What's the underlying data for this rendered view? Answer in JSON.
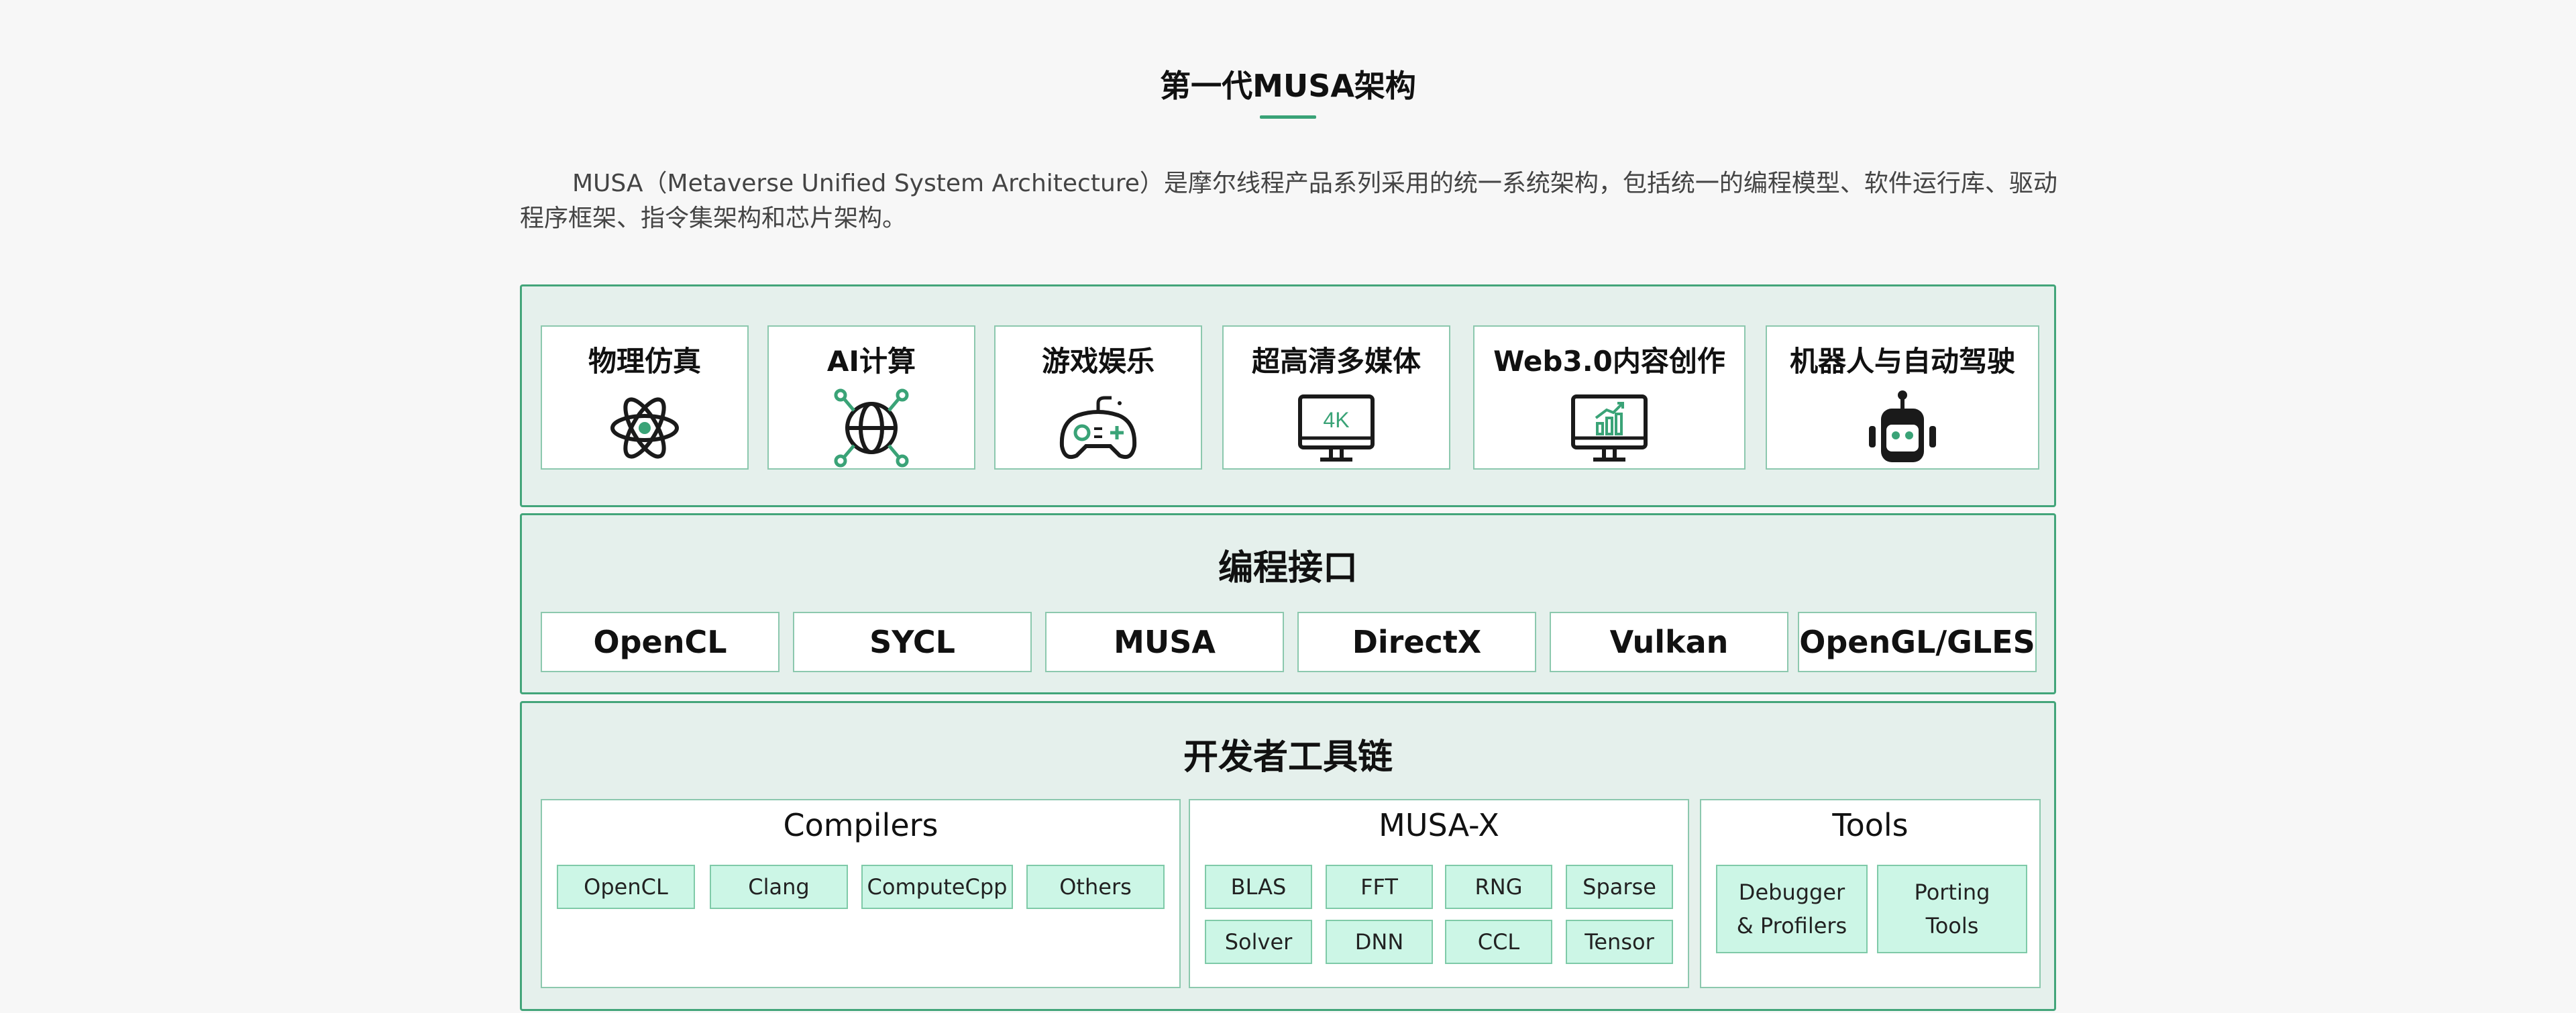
{
  "header": {
    "title": "第一代MUSA架构",
    "intro": "MUSA（Metaverse Unified System Architecture）是摩尔线程产品系列采用的统一系统架构，包括统一的编程模型、软件运行库、驱动程序框架、指令集架构和芯片架构。"
  },
  "applications": [
    {
      "label": "物理仿真",
      "icon": "atom-icon"
    },
    {
      "label": "AI计算",
      "icon": "ai-globe-icon"
    },
    {
      "label": "游戏娱乐",
      "icon": "gamepad-icon"
    },
    {
      "label": "超高清多媒体",
      "icon": "monitor-4k-icon",
      "icon_text": "4K"
    },
    {
      "label": "Web3.0内容创作",
      "icon": "monitor-chart-icon"
    },
    {
      "label": "机器人与自动驾驶",
      "icon": "robot-icon"
    }
  ],
  "programming": {
    "heading": "编程接口",
    "apis": [
      "OpenCL",
      "SYCL",
      "MUSA",
      "DirectX",
      "Vulkan",
      "OpenGL/GLES"
    ]
  },
  "toolchain": {
    "heading": "开发者工具链",
    "compilers": {
      "title": "Compilers",
      "items": [
        "OpenCL",
        "Clang",
        "ComputeCpp",
        "Others"
      ]
    },
    "musax": {
      "title": "MUSA-X",
      "items": [
        "BLAS",
        "FFT",
        "RNG",
        "Sparse",
        "Solver",
        "DNN",
        "CCL",
        "Tensor"
      ]
    },
    "tools": {
      "title": "Tools",
      "items": [
        {
          "line1": "Debugger",
          "line2": "& Profilers"
        },
        {
          "line1": "Porting",
          "line2": "Tools"
        }
      ]
    }
  },
  "colors": {
    "accent": "#3aa377",
    "layer_bg": "#e5f0ec",
    "chip_bg": "#ccf6e6",
    "border": "#8cc8ae"
  }
}
